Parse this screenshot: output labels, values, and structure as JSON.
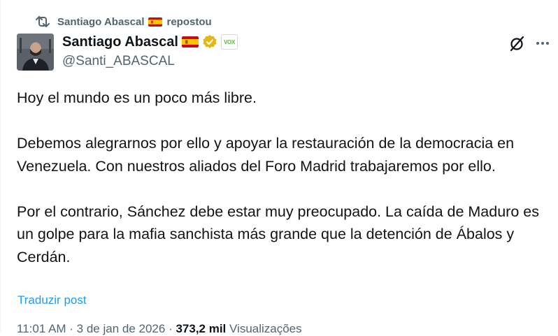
{
  "repost": {
    "name": "Santiago Abascal",
    "label": "repostou"
  },
  "author": {
    "name": "Santiago Abascal",
    "handle": "@Santi_ABASCAL",
    "badge_text": "VOX"
  },
  "post": {
    "paragraphs": [
      "Hoy el mundo es un poco más libre.",
      "Debemos alegrarnos por ello y apoyar la restauración de la democracia en Venezuela. Con nuestros aliados del Foro Madrid trabajaremos por ello.",
      "Por el contrario, Sánchez debe estar muy preocupado. La caída de Maduro es un golpe para la mafia sanchista  más grande que la detención de Ábalos y Cerdán."
    ],
    "translate_label": "Traduzir post"
  },
  "meta": {
    "time": "11:01 AM · 3 de jan de 2026 · ",
    "views": "373,2 mil",
    "views_label": " Visualizações"
  },
  "colors": {
    "text": "#0f1419",
    "secondary": "#536471",
    "link": "#1d9bf0",
    "verified_gold": "#e2b719",
    "vox_green": "#5fb936"
  },
  "icons": {
    "repost": "repost-icon",
    "verified": "verified-badge-icon",
    "grok": "grok-icon",
    "more": "more-icon",
    "flag": "spain-flag-icon"
  }
}
